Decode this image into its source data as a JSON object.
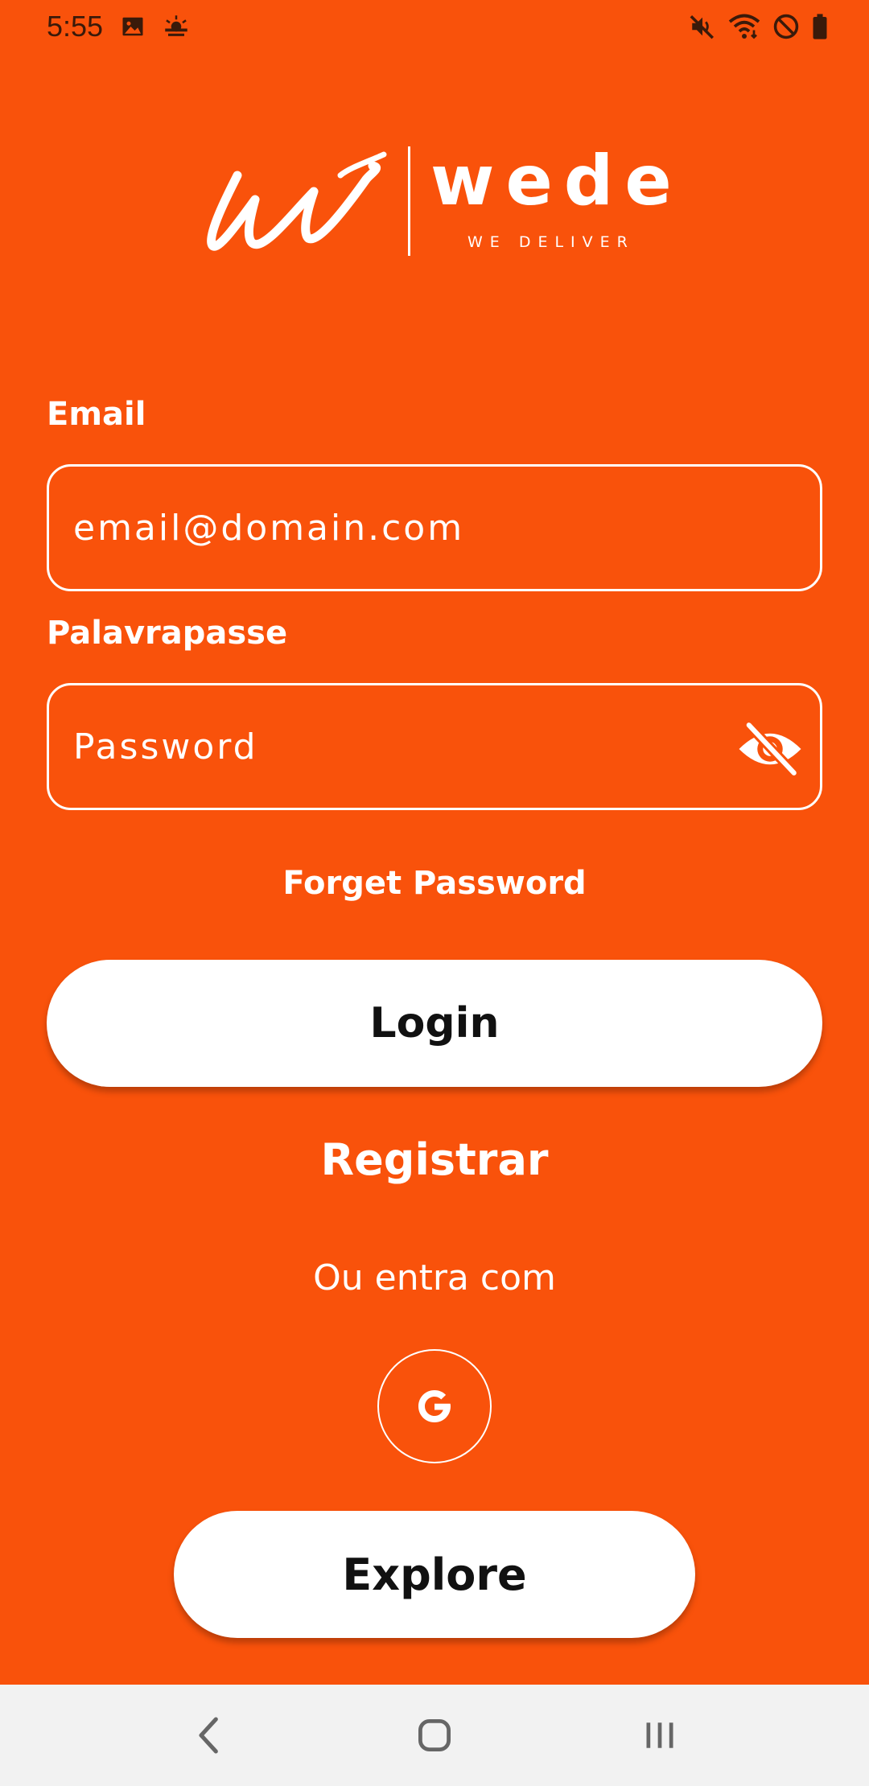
{
  "status_bar": {
    "time": "5:55",
    "left_icons": [
      "image-icon",
      "weather-icon"
    ],
    "right_icons": [
      "mute-icon",
      "wifi-icon",
      "do-not-disturb-icon",
      "battery-icon"
    ]
  },
  "logo": {
    "wordmark": "wede",
    "tagline": "WE DELIVER"
  },
  "form": {
    "email_label": "Email",
    "email_placeholder": "email@domain.com",
    "password_label": "Palavrapasse",
    "password_placeholder": "Password",
    "password_toggle_icon": "eye-off-icon"
  },
  "actions": {
    "forget_password": "Forget Password",
    "login": "Login",
    "register": "Registrar",
    "or_login_with": "Ou entra com",
    "google_icon": "google-icon",
    "explore": "Explore"
  },
  "nav_bar": {
    "buttons": [
      "back-icon",
      "home-icon",
      "recents-icon"
    ]
  },
  "colors": {
    "background": "#F9520B",
    "button": "#FFFFFF",
    "button_text": "#111111",
    "nav_bar": "#F2F2F2"
  }
}
